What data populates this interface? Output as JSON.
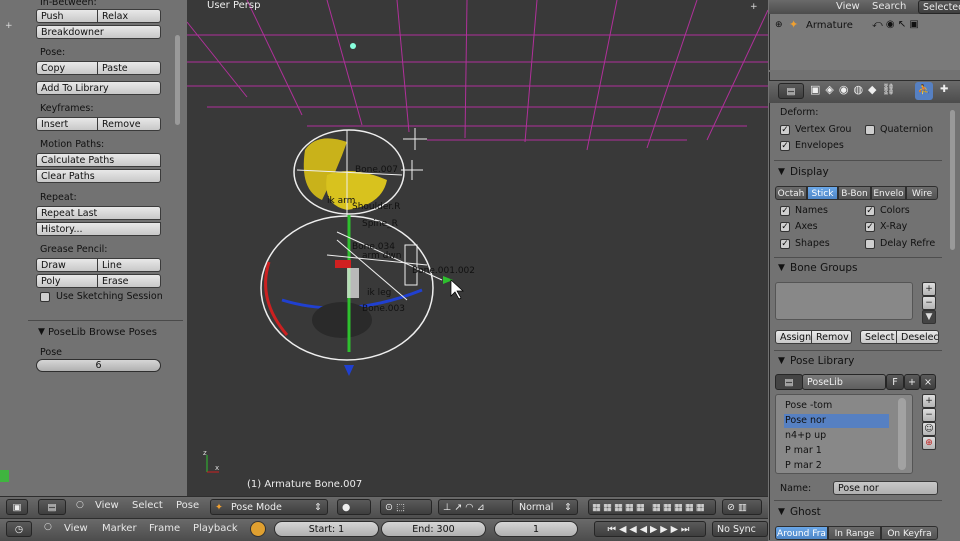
{
  "viewport": {
    "label": "User Persp",
    "object_label": "(1) Armature Bone.007",
    "bone_labels": [
      "Bone.007",
      "ik arm",
      "Shoulder.R",
      "Spine_R",
      "Bone.034",
      "arm dwn",
      "Bone.001.002",
      "Bone.003",
      "ik leg"
    ]
  },
  "tool_shelf": {
    "inbetween_header": "In-Between:",
    "push": "Push",
    "relax": "Relax",
    "breakdowner": "Breakdowner",
    "pose_header": "Pose:",
    "copy": "Copy",
    "paste": "Paste",
    "add_to_library": "Add To Library",
    "keyframes_header": "Keyframes:",
    "insert": "Insert",
    "remove": "Remove",
    "motion_paths_header": "Motion Paths:",
    "calculate_paths": "Calculate Paths",
    "clear_paths": "Clear Paths",
    "repeat_header": "Repeat:",
    "repeat_last": "Repeat Last",
    "history": "History...",
    "grease_header": "Grease Pencil:",
    "draw": "Draw",
    "line": "Line",
    "poly": "Poly",
    "erase": "Erase",
    "use_sketching": "Use Sketching Session",
    "poselib_panel": "PoseLib Browse Poses",
    "pose_label": "Pose",
    "pose_value": "6"
  },
  "view3d_header": {
    "view": "View",
    "select": "Select",
    "pose": "Pose",
    "mode": "Pose Mode",
    "pivot": "Normal"
  },
  "timeline": {
    "view": "View",
    "marker": "Marker",
    "frame": "Frame",
    "playback": "Playback",
    "start": "Start: 1",
    "end": "End: 300",
    "current": "1",
    "sync": "No Sync"
  },
  "outliner": {
    "view": "View",
    "search": "Search",
    "selected": "Selected",
    "item": "Armature"
  },
  "properties": {
    "deform_header": "Deform:",
    "vertex_groups": "Vertex Grou",
    "quaternion": "Quaternion",
    "envelopes": "Envelopes",
    "display_panel": "Display",
    "display_tabs": [
      "Octah",
      "Stick",
      "B-Bon",
      "Envelo",
      "Wire"
    ],
    "names": "Names",
    "colors": "Colors",
    "axes": "Axes",
    "xray": "X-Ray",
    "shapes": "Shapes",
    "delay_refresh": "Delay Refre",
    "bone_groups_panel": "Bone Groups",
    "assign": "Assign",
    "remove": "Remov",
    "select": "Select",
    "deselect": "Deselec",
    "pose_library_panel": "Pose Library",
    "poselib_name": "PoseLib",
    "fake_user": "F",
    "poses": [
      "Pose -tom",
      "Pose nor",
      "n4+p up",
      "P mar 1",
      "P mar 2"
    ],
    "name_label": "Name:",
    "name_value": "Pose nor",
    "ghost_panel": "Ghost",
    "ghost_tabs": [
      "Around Fra",
      "In Range",
      "On Keyfra"
    ]
  },
  "colors": {
    "selection": "#5680c2",
    "grid": "#b0309a",
    "accent": "#4f86c6"
  }
}
